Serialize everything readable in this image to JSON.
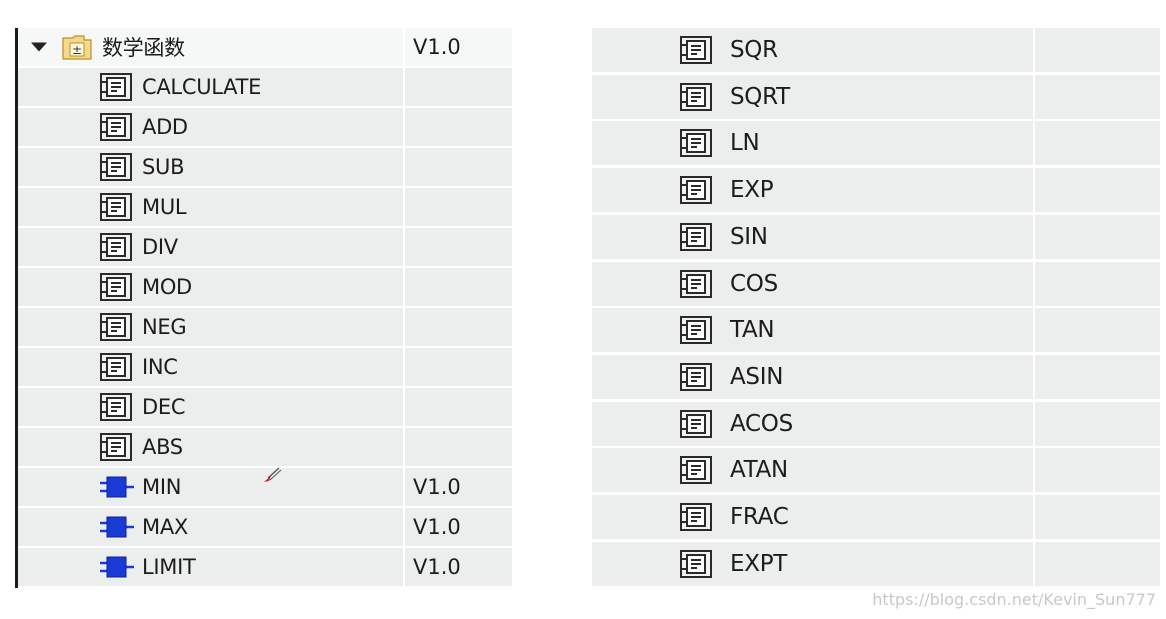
{
  "left_tree": {
    "header": {
      "label": "数学函数",
      "version": "V1.0"
    },
    "items": [
      {
        "label": "CALCULATE",
        "version": "",
        "icon": "instruction-box-icon"
      },
      {
        "label": "ADD",
        "version": "",
        "icon": "instruction-box-icon"
      },
      {
        "label": "SUB",
        "version": "",
        "icon": "instruction-box-icon"
      },
      {
        "label": "MUL",
        "version": "",
        "icon": "instruction-box-icon"
      },
      {
        "label": "DIV",
        "version": "",
        "icon": "instruction-box-icon"
      },
      {
        "label": "MOD",
        "version": "",
        "icon": "instruction-box-icon"
      },
      {
        "label": "NEG",
        "version": "",
        "icon": "instruction-box-icon"
      },
      {
        "label": "INC",
        "version": "",
        "icon": "instruction-box-icon"
      },
      {
        "label": "DEC",
        "version": "",
        "icon": "instruction-box-icon"
      },
      {
        "label": "ABS",
        "version": "",
        "icon": "instruction-box-icon"
      },
      {
        "label": "MIN",
        "version": "V1.0",
        "icon": "function-block-icon"
      },
      {
        "label": "MAX",
        "version": "V1.0",
        "icon": "function-block-icon"
      },
      {
        "label": "LIMIT",
        "version": "V1.0",
        "icon": "function-block-icon"
      }
    ]
  },
  "right_list": {
    "items": [
      {
        "label": "SQR",
        "version": "",
        "icon": "instruction-box-icon"
      },
      {
        "label": "SQRT",
        "version": "",
        "icon": "instruction-box-icon"
      },
      {
        "label": "LN",
        "version": "",
        "icon": "instruction-box-icon"
      },
      {
        "label": "EXP",
        "version": "",
        "icon": "instruction-box-icon"
      },
      {
        "label": "SIN",
        "version": "",
        "icon": "instruction-box-icon"
      },
      {
        "label": "COS",
        "version": "",
        "icon": "instruction-box-icon"
      },
      {
        "label": "TAN",
        "version": "",
        "icon": "instruction-box-icon"
      },
      {
        "label": "ASIN",
        "version": "",
        "icon": "instruction-box-icon"
      },
      {
        "label": "ACOS",
        "version": "",
        "icon": "instruction-box-icon"
      },
      {
        "label": "ATAN",
        "version": "",
        "icon": "instruction-box-icon"
      },
      {
        "label": "FRAC",
        "version": "",
        "icon": "instruction-box-icon"
      },
      {
        "label": "EXPT",
        "version": "",
        "icon": "instruction-box-icon"
      }
    ]
  },
  "watermark": "https://blog.csdn.net/Kevin_Sun777",
  "colors": {
    "row_bg": "#eceeee",
    "header_bg": "#f6f7f7",
    "text": "#1c1c1c",
    "folder_fill": "#f5d98a",
    "block_blue": "#1a3ad6"
  }
}
